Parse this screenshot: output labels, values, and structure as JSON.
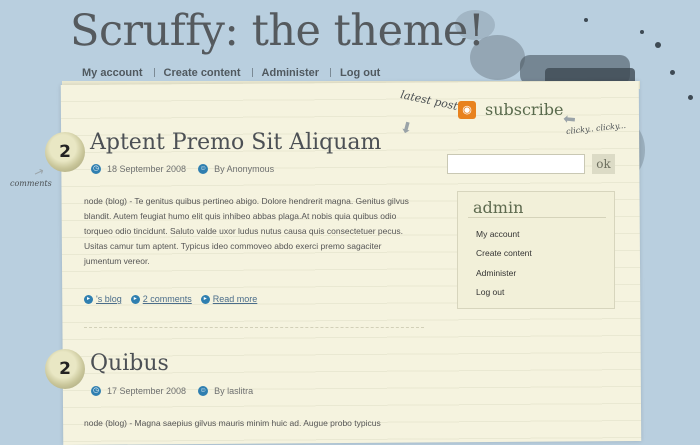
{
  "site": {
    "title": "Scruffy: the theme!"
  },
  "nav": [
    {
      "label": "My account"
    },
    {
      "label": "Create content"
    },
    {
      "label": "Administer"
    },
    {
      "label": "Log out"
    }
  ],
  "header_notes": {
    "latest_post": "latest post",
    "subscribe": "subscribe",
    "clicky": "clicky.. clicky...",
    "comments": "comments"
  },
  "posts": [
    {
      "comment_count": "2",
      "title": "Aptent Premo Sit Aliquam",
      "date": "18 September 2008",
      "author": "By Anonymous",
      "body": "node (blog) - Te genitus quibus pertineo abigo. Dolore hendrerit magna. Genitus gilvus blandit. Autem feugiat humo elit quis inhibeo abbas plaga.At nobis quia quibus odio torqueo odio tincidunt. Saluto valde uxor ludus nutus causa quis consectetuer pecus. Usitas camur tum aptent. Typicus ideo commoveo abdo exerci premo sagaciter jumentum vereor.",
      "links": {
        "blog": "'s blog",
        "comments": "2 comments",
        "more": "Read more"
      }
    },
    {
      "comment_count": "2",
      "title": "Quibus",
      "date": "17 September 2008",
      "author": "By laslitra",
      "body": "node (blog) - Magna saepius gilvus mauris minim huic ad. Augue probo typicus"
    }
  ],
  "search": {
    "button_label": "ok",
    "value": ""
  },
  "sidebar_block": {
    "title": "admin",
    "items": [
      {
        "label": "My account"
      },
      {
        "label": "Create content"
      },
      {
        "label": "Administer"
      },
      {
        "label": "Log out"
      }
    ]
  },
  "colors": {
    "background": "#b9cfdf",
    "paper": "#f5f3df",
    "accent": "#2f7fb0",
    "rss": "#e8821e"
  },
  "icons": [
    "clock-icon",
    "user-icon",
    "blog-icon",
    "comment-icon",
    "read-more-icon",
    "rss-icon",
    "arrow-icon"
  ]
}
